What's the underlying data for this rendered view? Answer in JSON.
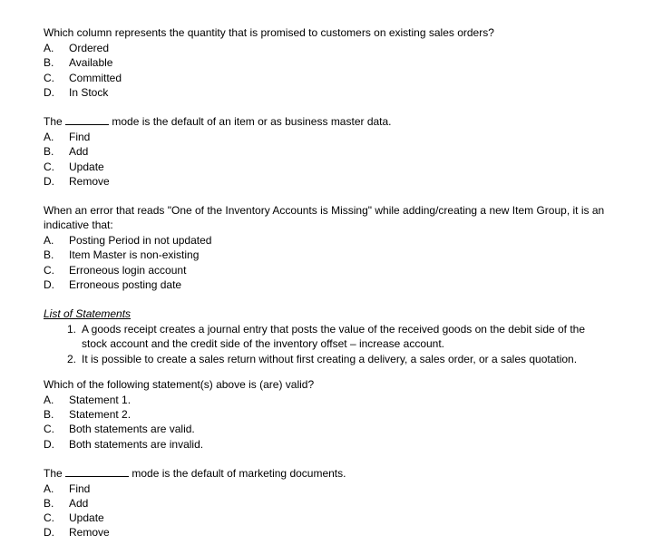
{
  "q1": {
    "text": "Which column represents the quantity that is promised to customers on existing sales orders?",
    "opts": {
      "A": "Ordered",
      "B": "Available",
      "C": "Committed",
      "D": "In Stock"
    }
  },
  "q2": {
    "pre": "The ",
    "post": " mode is the default of an item or as business master data.",
    "opts": {
      "A": "Find",
      "B": "Add",
      "C": "Update",
      "D": "Remove"
    }
  },
  "q3": {
    "text": "When an error that reads \"One of the Inventory Accounts is Missing\" while adding/creating a new Item Group, it is an indicative that:",
    "opts": {
      "A": "Posting Period in not updated",
      "B": "Item Master is non-existing",
      "C": "Erroneous login account",
      "D": "Erroneous posting date"
    }
  },
  "list": {
    "header": "List of Statements",
    "items": {
      "1": "A goods receipt creates a journal entry that posts the value of the received goods on the debit side of the stock account and the credit side of the inventory offset – increase account.",
      "2": "It is possible to create a sales return without first creating a delivery, a sales order, or a sales quotation."
    }
  },
  "q4": {
    "text": "Which of the following statement(s) above is (are) valid?",
    "opts": {
      "A": "Statement 1.",
      "B": "Statement 2.",
      "C": "Both statements are valid.",
      "D": "Both statements are invalid."
    }
  },
  "q5": {
    "pre": "The ",
    "post": " mode is the default of marketing documents.",
    "opts": {
      "A": "Find",
      "B": "Add",
      "C": "Update",
      "D": "Remove"
    }
  },
  "letters": {
    "A": "A.",
    "B": "B.",
    "C": "C.",
    "D": "D."
  },
  "nums": {
    "1": "1.",
    "2": "2."
  }
}
